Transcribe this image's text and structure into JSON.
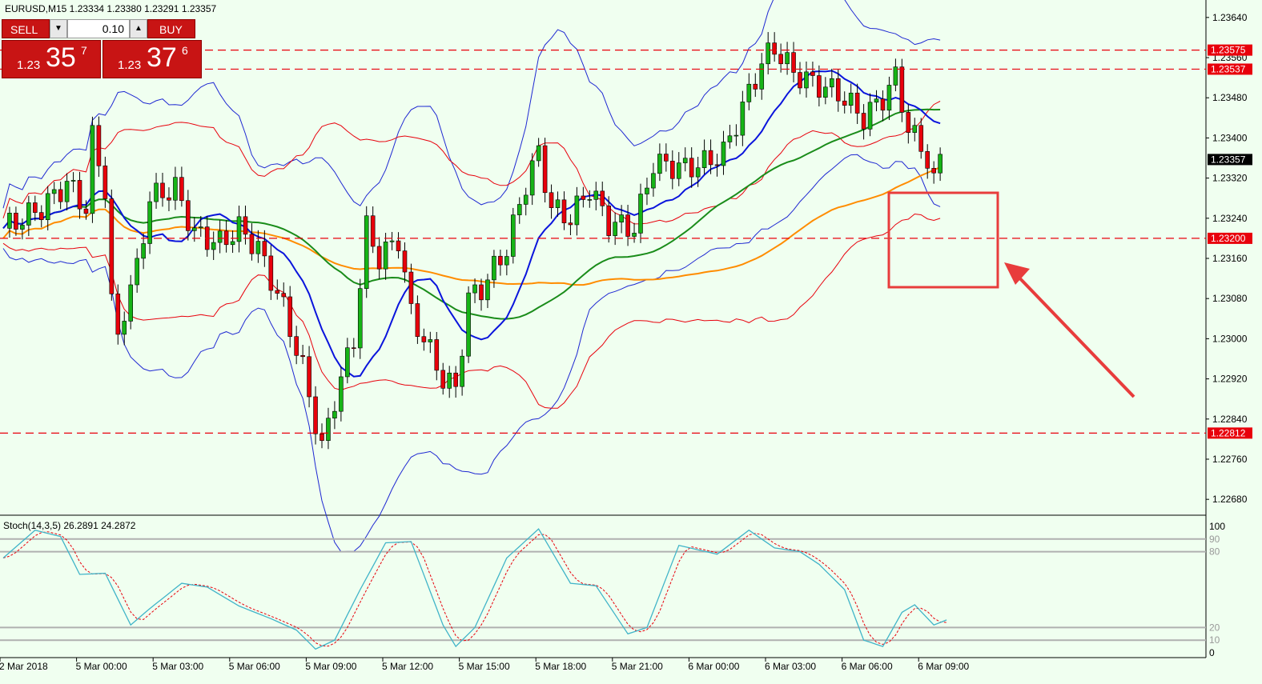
{
  "chart_data": {
    "type": "candlestick",
    "title": "EURUSD,M15  1.23334 1.23380 1.23291 1.23357",
    "y_axis": {
      "ticks": [
        "1.23640",
        "1.23560",
        "1.23480",
        "1.23400",
        "1.23320",
        "1.23240",
        "1.23160",
        "1.23080",
        "1.23000",
        "1.22920",
        "1.22840",
        "1.22760",
        "1.22680"
      ],
      "range": [
        1.2265,
        1.2367
      ]
    },
    "x_axis": {
      "ticks": [
        "2 Mar 2018",
        "5 Mar 00:00",
        "5 Mar 03:00",
        "5 Mar 06:00",
        "5 Mar 09:00",
        "5 Mar 12:00",
        "5 Mar 15:00",
        "5 Mar 18:00",
        "5 Mar 21:00",
        "6 Mar 00:00",
        "6 Mar 03:00",
        "6 Mar 06:00",
        "6 Mar 09:00"
      ]
    },
    "levels": [
      {
        "value": 1.23575,
        "label": "1.23575",
        "color": "#e8000b"
      },
      {
        "value": 1.23537,
        "label": "1.23537",
        "color": "#e8000b"
      },
      {
        "value": 1.232,
        "label": "1.23200",
        "color": "#e8000b"
      },
      {
        "value": 1.22812,
        "label": "1.22812",
        "color": "#e8000b"
      }
    ],
    "current_price": {
      "value": 1.23357,
      "label": "1.23357"
    },
    "indicator": {
      "title": "Stoch(14,3,5) 26.2891 24.2872",
      "scale": [
        "100",
        "90",
        "80",
        "20",
        "10",
        "0"
      ]
    },
    "colors": {
      "bull": "#16b416",
      "bear": "#e8000b",
      "grid": "#b0b0b0"
    },
    "annotations": [
      {
        "shape": "rectangle",
        "color": "#e83c3c"
      },
      {
        "shape": "arrow",
        "color": "#e83c3c"
      }
    ]
  },
  "trade_panel": {
    "sell_label": "SELL",
    "buy_label": "BUY",
    "lot": "0.10",
    "sell_prefix": "1.23",
    "sell_big": "35",
    "sell_sup": "7",
    "buy_prefix": "1.23",
    "buy_big": "37",
    "buy_sup": "6"
  }
}
